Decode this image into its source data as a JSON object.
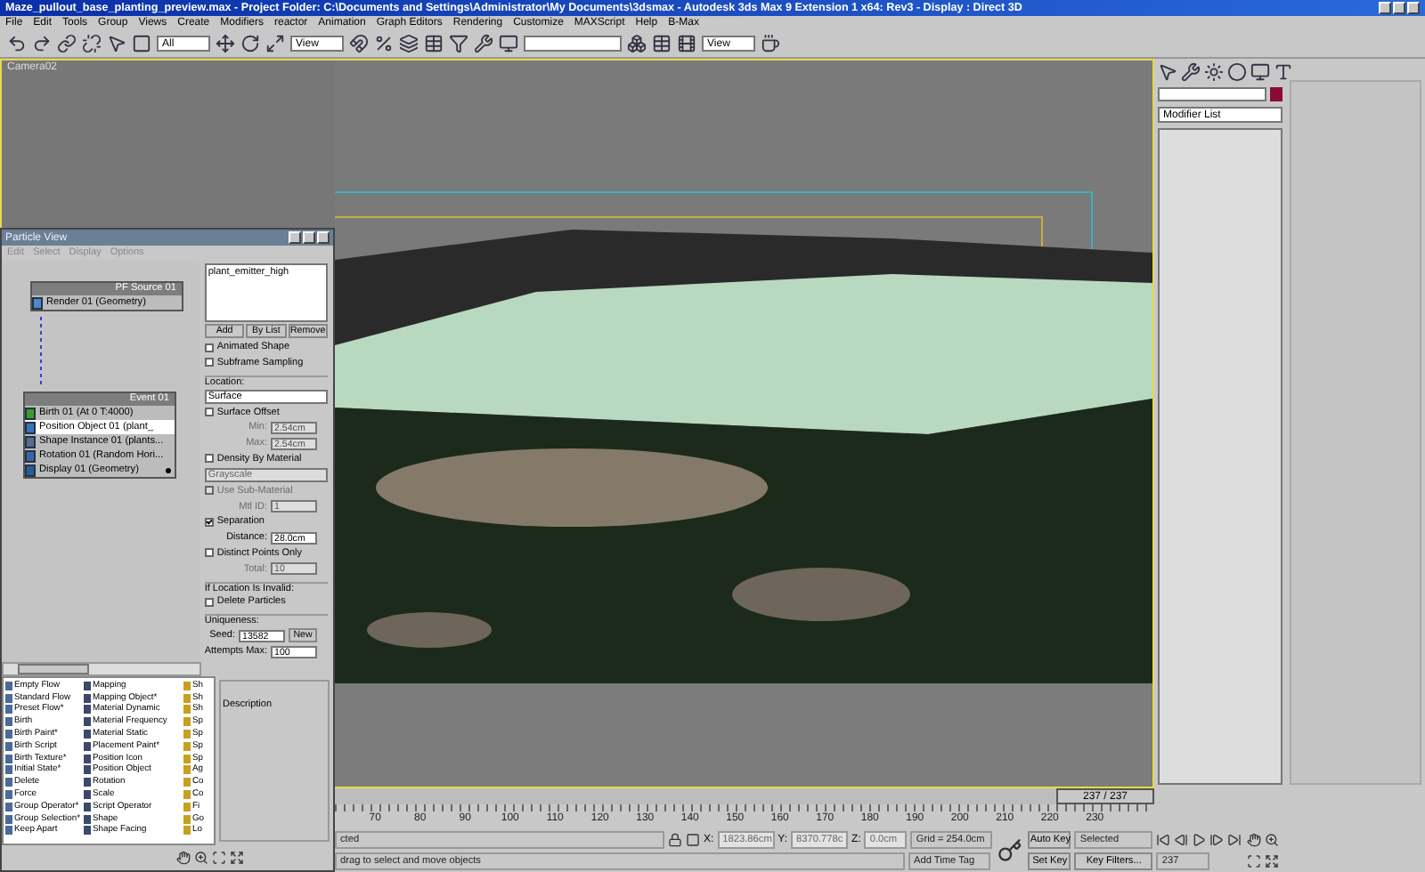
{
  "window": {
    "title": "Maze_pullout_base_planting_preview.max   - Project Folder: C:\\Documents and Settings\\Administrator\\My Documents\\3dsmax    - Autodesk 3ds Max 9 Extension 1 x64: Rev3    - Display : Direct 3D"
  },
  "menu": [
    "File",
    "Edit",
    "Tools",
    "Group",
    "Views",
    "Create",
    "Modifiers",
    "reactor",
    "Animation",
    "Graph Editors",
    "Rendering",
    "Customize",
    "MAXScript",
    "Help",
    "B-Max"
  ],
  "toolbar": {
    "selection_filter": "All",
    "reference_coordinate": "View",
    "render_mode": "View"
  },
  "viewport": {
    "label": "Camera02"
  },
  "command_panel": {
    "color": "#8b0a3a",
    "modifier_list": "Modifier List"
  },
  "particle_view": {
    "title": "Particle View",
    "menu": [
      "Edit",
      "Select",
      "Display",
      "Options"
    ],
    "nodes": [
      {
        "header": "PF Source 01",
        "items": [
          {
            "kind": "render",
            "label": "Render 01 (Geometry)",
            "selected": false
          }
        ]
      },
      {
        "header": "Event 01",
        "items": [
          {
            "kind": "birth",
            "label": "Birth 01 (At 0 T:4000)",
            "selected": false
          },
          {
            "kind": "position",
            "label": "Position Object 01 (plant_",
            "selected": true
          },
          {
            "kind": "shape",
            "label": "Shape Instance 01 (plants...",
            "selected": false
          },
          {
            "kind": "rotation",
            "label": "Rotation 01 (Random Hori...",
            "selected": false
          },
          {
            "kind": "display",
            "label": "Display 01 (Geometry)",
            "selected": false
          }
        ]
      }
    ],
    "params": [
      {
        "kind": "listbox",
        "items": [
          "plant_emitter_high"
        ]
      },
      {
        "kind": "buttons",
        "labels": [
          "Add",
          "By List",
          "Remove"
        ]
      },
      {
        "kind": "checkbox",
        "label": "Animated Shape",
        "checked": false,
        "disabled": false
      },
      {
        "kind": "checkbox",
        "label": "Subframe Sampling",
        "checked": false,
        "disabled": false
      },
      {
        "kind": "group",
        "label": "Location:"
      },
      {
        "kind": "dropdown",
        "value": "Surface",
        "disabled": false
      },
      {
        "kind": "checkbox",
        "label": "Surface Offset",
        "checked": false,
        "disabled": false
      },
      {
        "kind": "spinner",
        "label": "Min:",
        "value": "2.54cm",
        "disabled": true
      },
      {
        "kind": "spinner",
        "label": "Max:",
        "value": "2.54cm",
        "disabled": true
      },
      {
        "kind": "checkbox",
        "label": "Density By Material",
        "checked": false,
        "disabled": false
      },
      {
        "kind": "dropdown",
        "value": "Grayscale",
        "disabled": true
      },
      {
        "kind": "checkbox",
        "label": "Use Sub-Material",
        "checked": false,
        "disabled": true
      },
      {
        "kind": "spinner",
        "label": "Mtl ID:",
        "value": "1",
        "disabled": true
      },
      {
        "kind": "checkbox",
        "label": "Separation",
        "checked": true,
        "disabled": false
      },
      {
        "kind": "spinner",
        "label": "Distance:",
        "value": "28.0cm",
        "disabled": false
      },
      {
        "kind": "checkbox",
        "label": "Distinct Points Only",
        "checked": false,
        "disabled": false
      },
      {
        "kind": "spinner",
        "label": "Total:",
        "value": "10",
        "disabled": true
      },
      {
        "kind": "group",
        "label": "If Location Is Invalid:"
      },
      {
        "kind": "checkbox",
        "label": "Delete Particles",
        "checked": false,
        "disabled": false
      },
      {
        "kind": "group",
        "label": "Uniqueness:"
      },
      {
        "kind": "seed",
        "label": "Seed:",
        "value": "13582",
        "button": "New"
      },
      {
        "kind": "spinner",
        "label": "Attempts Max:",
        "value": "100",
        "disabled": false
      }
    ],
    "description_label": "Description",
    "depot": [
      [
        "Empty Flow",
        "Standard Flow",
        "Preset Flow*",
        "Birth",
        "Birth Paint*",
        "Birth Script",
        "Birth Texture*",
        "Initial State*",
        "Delete",
        "Force",
        "Group Operator*",
        "Group Selection*",
        "Keep Apart"
      ],
      [
        "Mapping",
        "Mapping Object*",
        "Material Dynamic",
        "Material Frequency",
        "Material Static",
        "Placement Paint*",
        "Position Icon",
        "Position Object",
        "Rotation",
        "Scale",
        "Script Operator",
        "Shape",
        "Shape Facing"
      ],
      [
        "Sh",
        "Sh",
        "Sh",
        "Sp",
        "Sp",
        "Sp",
        "Sp",
        "Ag",
        "Co",
        "Co",
        "Fi",
        "Go",
        "Lo"
      ]
    ]
  },
  "time_slider": {
    "label": "237 / 237",
    "level": 1
  },
  "ruler": [
    "70",
    "80",
    "90",
    "100",
    "110",
    "120",
    "130",
    "140",
    "150",
    "160",
    "170",
    "180",
    "190",
    "200",
    "210",
    "220",
    "230"
  ],
  "status": {
    "selection": "cted",
    "prompt": "drag to select and move objects",
    "x_label": "X:",
    "x": "1823.86cm",
    "y_label": "Y:",
    "y": "8370.778c",
    "z_label": "Z:",
    "z": "0.0cm",
    "grid": "Grid = 254.0cm",
    "time_tag": "Add Time Tag",
    "auto_key": "Auto Key",
    "key_mode": "Selected",
    "set_key": "Set Key",
    "key_filters": "Key Filters...",
    "frame": "237"
  }
}
